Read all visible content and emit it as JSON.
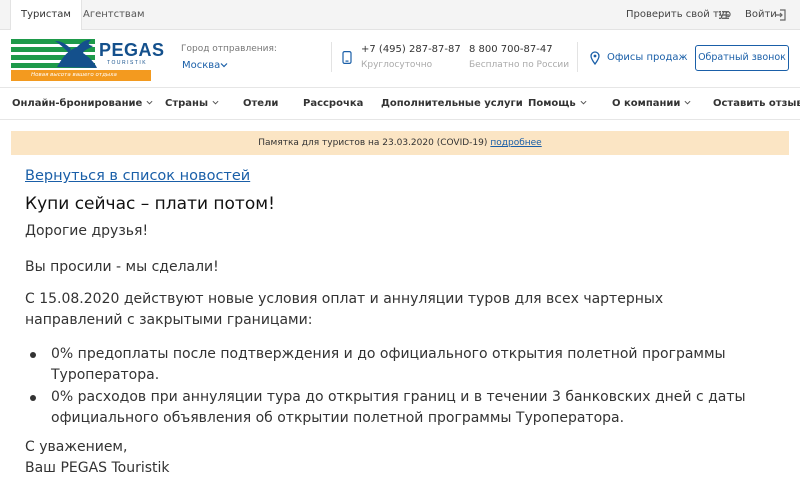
{
  "topbar": {
    "tabs": [
      {
        "label": "Туристам",
        "active": true
      },
      {
        "label": "Агентствам",
        "active": false
      }
    ],
    "check_tour": "Проверить свой тур",
    "login": "Войти"
  },
  "header": {
    "logo": {
      "brand": "PEGAS",
      "sub": "TOURISTIK",
      "slogan": "Новая высота вашего отдыха"
    },
    "city_label": "Город отправления:",
    "city_value": "Москва",
    "phone1": "+7 (495) 287-87-87",
    "phone1_note": "Круглосуточно",
    "phone2": "8 800 700-87-47",
    "phone2_note": "Бесплатно по России",
    "offices": "Офисы продаж",
    "callback": "Обратный звонок"
  },
  "nav": {
    "items": [
      {
        "label": "Онлайн-бронирование",
        "dropdown": true
      },
      {
        "label": "Страны",
        "dropdown": true
      },
      {
        "label": "Отели",
        "dropdown": false
      },
      {
        "label": "Рассрочка",
        "dropdown": false
      },
      {
        "label": "Дополнительные услуги",
        "dropdown": false
      },
      {
        "label": "Помощь",
        "dropdown": true
      },
      {
        "label": "О компании",
        "dropdown": true
      },
      {
        "label": "Оставить отзыв",
        "dropdown": false
      }
    ]
  },
  "notice": {
    "text": "Памятка для туристов на 23.03.2020 (COVID-19)",
    "link": "подробнее"
  },
  "article": {
    "back_link": "Вернуться в список новостей",
    "title": "Купи сейчас – плати потом!",
    "greeting": "Дорогие друзья!",
    "intro": "Вы просили - мы сделали!",
    "lead": "С 15.08.2020 действуют новые условия оплат и аннуляции туров для всех чартерных направлений с закрытыми границами:",
    "bullets": [
      "0% предоплаты после подтверждения и до официального открытия полетной программы Туроператора.",
      "0% расходов при аннуляции тура до открытия границ и в течении 3 банковских дней с даты официального объявления об открытии полетной программы Туроператора."
    ],
    "regards": "С уважением,",
    "signature": "Ваш PEGAS Touristik"
  },
  "colors": {
    "brand_blue": "#14508c",
    "link_blue": "#1a5fa8",
    "logo_green": "#1e9a4a",
    "logo_orange": "#f39a1f",
    "notice_bg": "#fbe5c4"
  },
  "icons": [
    "list-icon",
    "login-icon",
    "phone-icon",
    "map-pin-icon",
    "chevron-down-icon"
  ]
}
